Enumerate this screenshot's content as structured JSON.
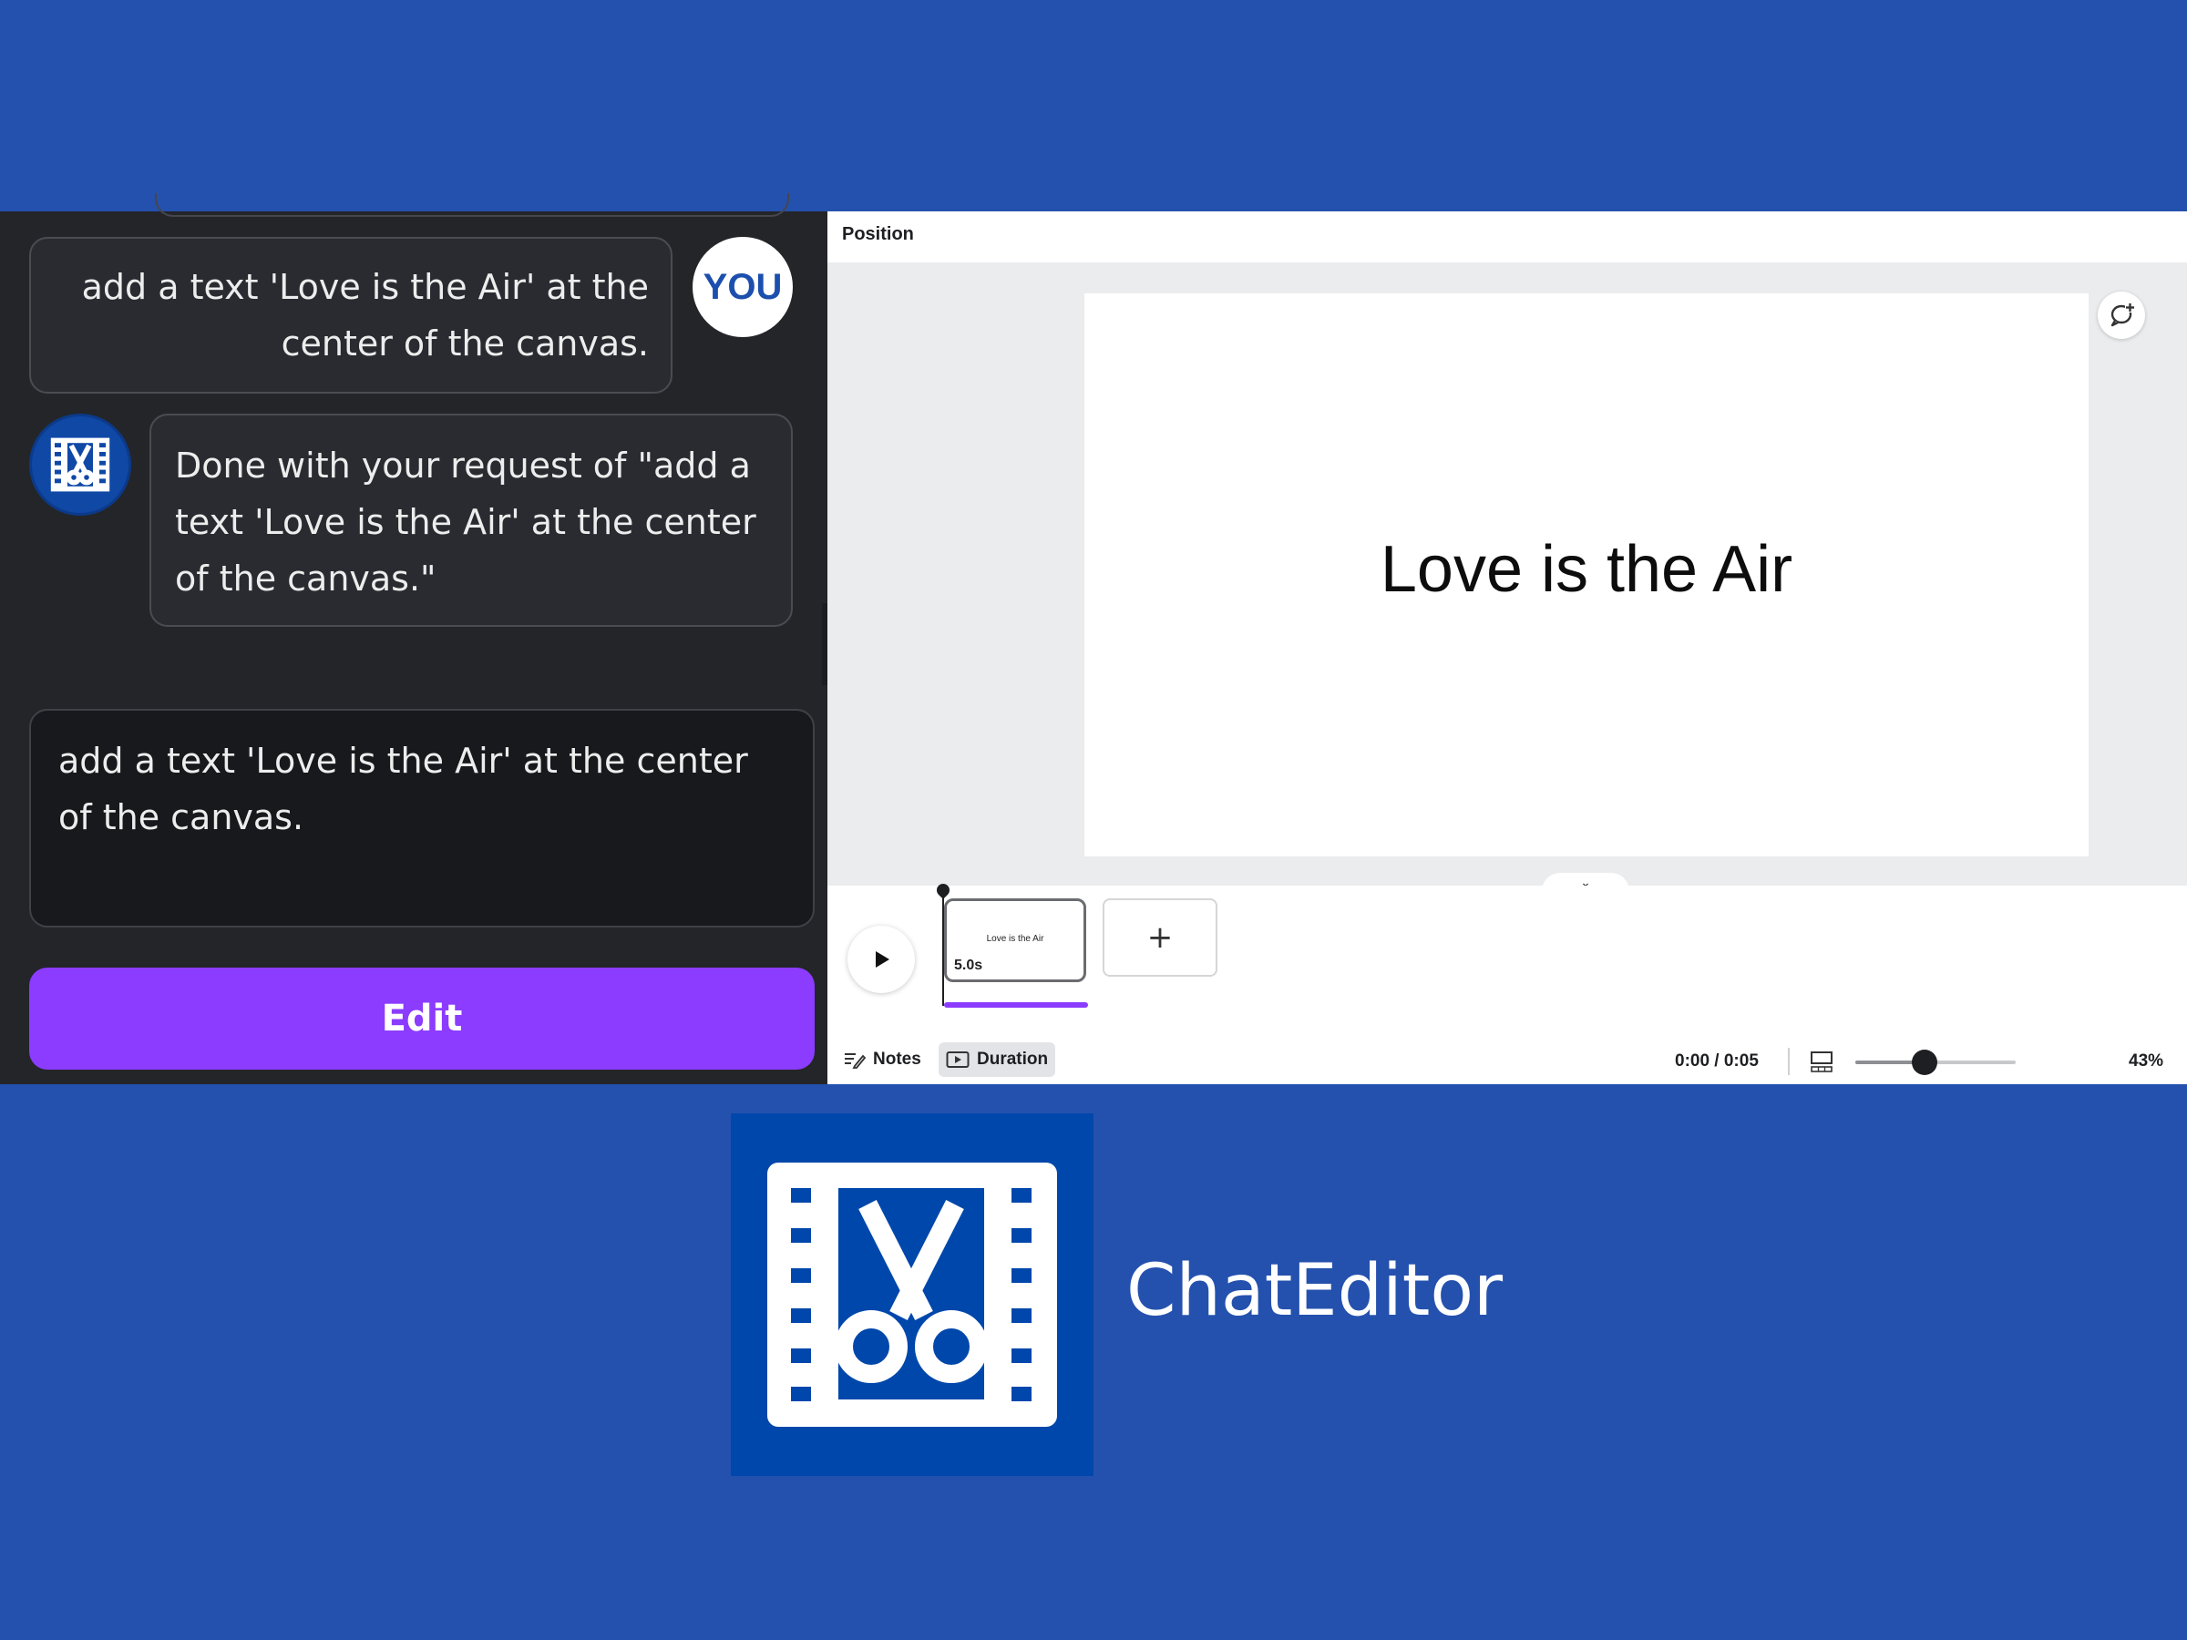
{
  "colors": {
    "background": "#2451ae",
    "chat_panel": "#242529",
    "accent_purple": "#8b3cff",
    "logo_blue": "#0047ab"
  },
  "chat": {
    "user_avatar_label": "YOU",
    "user_message": "add a text 'Love is the Air' at the center of the canvas.",
    "bot_avatar_icon": "film-scissors-icon",
    "bot_message": "Done with your request of \"add a text 'Love is the Air' at the center of the canvas.\"",
    "input_value": "add a text 'Love is the Air' at the center of the canvas.",
    "edit_button": "Edit"
  },
  "editor": {
    "toolbar_label": "Position",
    "canvas_text": "Love is the Air",
    "timeline": {
      "clip_title": "Love is the Air",
      "clip_duration": "5.0s",
      "add_clip_symbol": "+",
      "play_icon": "play-icon"
    },
    "bottom_bar": {
      "notes_label": "Notes",
      "duration_label": "Duration",
      "time_readout": "0:00 / 0:05",
      "zoom_percent": "43%",
      "zoom_value": 43
    }
  },
  "branding": {
    "app_name": "ChatEditor",
    "logo_icon": "film-scissors-icon"
  }
}
